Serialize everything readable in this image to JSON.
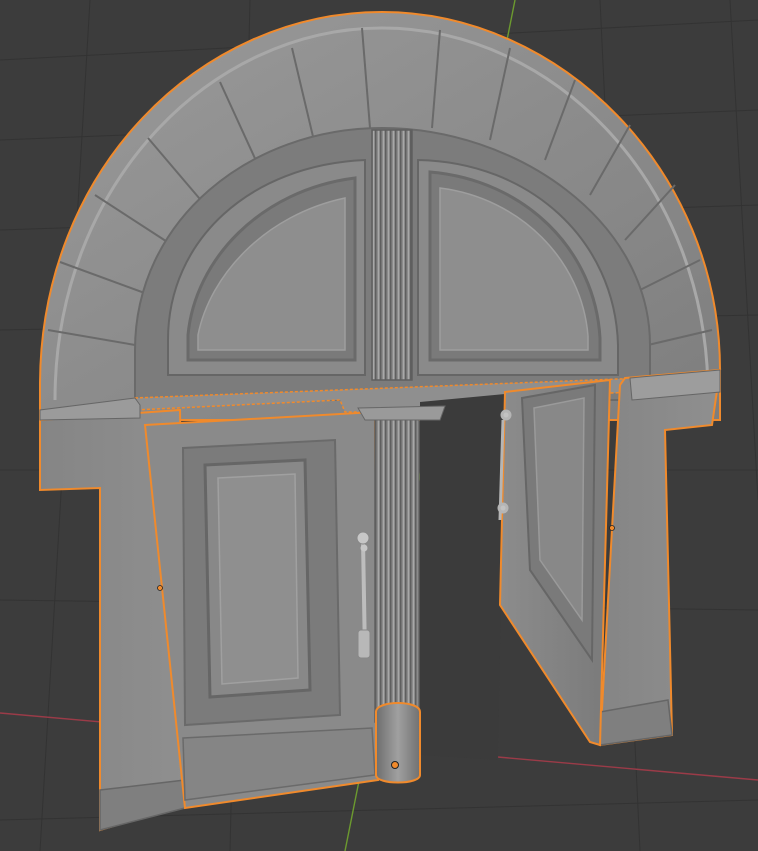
{
  "viewport": {
    "editor": "3D Viewport",
    "shading": "solid",
    "background_color": "#3c3c3c",
    "grid_color": "#303030",
    "x_axis_color": "#9b3b48",
    "y_axis_color": "#6c9a2f",
    "selection_outline_color": "#f08a2c",
    "model_base_color": "#8a8a8a"
  },
  "model": {
    "name": "arched-double-door",
    "parts": [
      "arch",
      "arch-voussoirs",
      "transom-panels",
      "central-column",
      "left-door",
      "right-door-open",
      "door-handles",
      "pilasters"
    ],
    "selected": true
  }
}
